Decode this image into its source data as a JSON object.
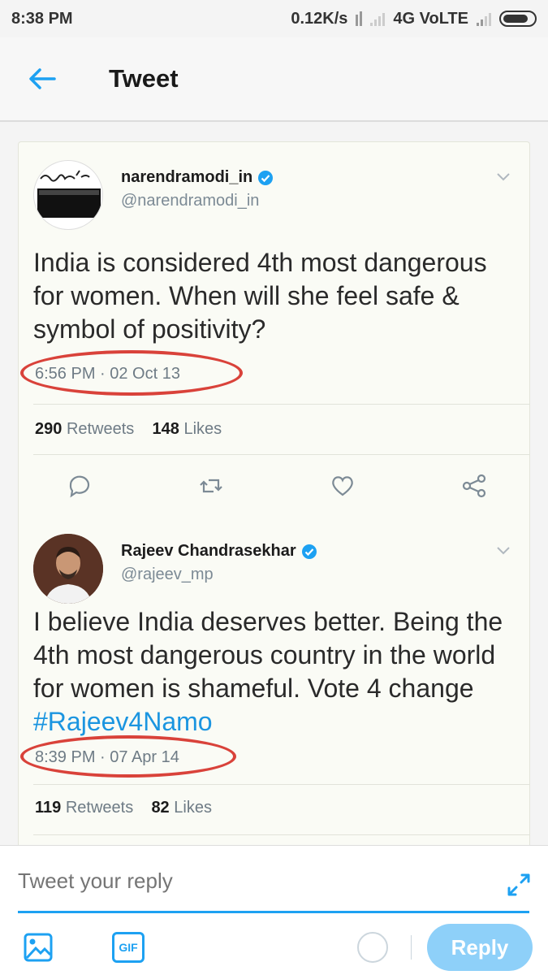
{
  "status_bar": {
    "time": "8:38 PM",
    "network_speed": "0.12K/s",
    "network_type": "4G VoLTE"
  },
  "header": {
    "title": "Tweet"
  },
  "tweets": [
    {
      "display_name": "narendramodi_in",
      "handle": "@narendramodi_in",
      "text": "India is considered 4th most dangerous for women. When will she feel safe & symbol of positivity?",
      "timestamp": "6:56 PM · 02 Oct 13",
      "retweets": "290",
      "retweets_label": "Retweets",
      "likes": "148",
      "likes_label": "Likes"
    },
    {
      "display_name": "Rajeev Chandrasekhar",
      "handle": "@rajeev_mp",
      "text_main": "I believe India deserves better. Being the 4th most dangerous country in the world for women is shameful. Vote 4 change ",
      "hashtag": "#Rajeev4Namo",
      "timestamp": "8:39 PM · 07 Apr 14",
      "retweets": "119",
      "retweets_label": "Retweets",
      "likes": "82",
      "likes_label": "Likes"
    }
  ],
  "reply": {
    "placeholder": "Tweet your reply",
    "gif_label": "GIF",
    "button_label": "Reply"
  },
  "colors": {
    "accent": "#1da1f2",
    "annotation": "#d9423a"
  }
}
